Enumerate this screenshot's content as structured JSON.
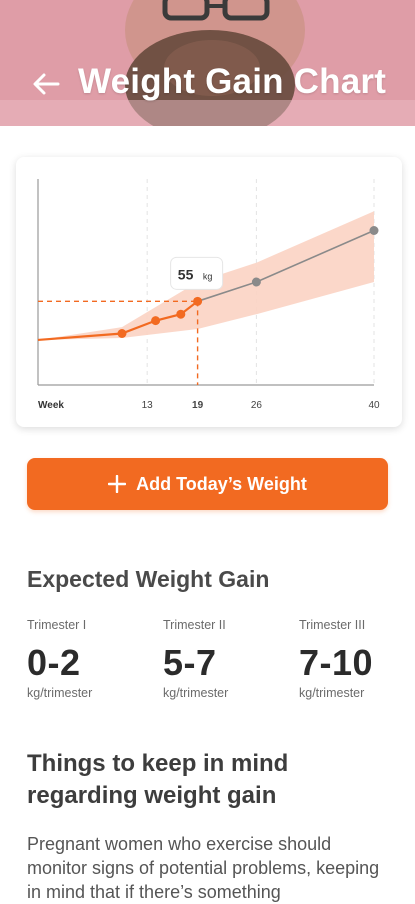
{
  "header": {
    "title": "Weight Gain Chart",
    "back_icon": "arrow-left-icon"
  },
  "chart_data": {
    "type": "line",
    "x_tick_labels": [
      "Week",
      "13",
      "19",
      "26",
      "40"
    ],
    "x_ticks": [
      13,
      19,
      26,
      40
    ],
    "xlim": [
      0,
      40
    ],
    "actual_series": {
      "x": [
        0,
        10,
        14,
        17,
        19
      ],
      "y": [
        47,
        48,
        50,
        51,
        53
      ]
    },
    "projected_series": {
      "x": [
        19,
        26,
        40
      ],
      "y": [
        53,
        56,
        64
      ]
    },
    "expected_range": {
      "x": [
        0,
        10,
        19,
        26,
        40
      ],
      "low": [
        47,
        47.3,
        48.7,
        51,
        56
      ],
      "high": [
        47,
        49,
        56,
        59,
        67
      ]
    },
    "highlight": {
      "x": 19,
      "y": 53,
      "label_value": "55",
      "label_unit": "kg"
    },
    "colors": {
      "accent": "#f26a21",
      "band": "#fbd3c3",
      "projected": "#8a8a8a",
      "grid": "#e3e3e3"
    }
  },
  "actions": {
    "add_weight_label": "Add Today’s Weight",
    "add_icon": "plus-icon"
  },
  "expected": {
    "title": "Expected Weight Gain",
    "trimesters": [
      {
        "name": "Trimester I",
        "value": "0-2",
        "unit": "kg/trimester"
      },
      {
        "name": "Trimester II",
        "value": "5-7",
        "unit": "kg/trimester"
      },
      {
        "name": "Trimester III",
        "value": "7-10",
        "unit": "kg/trimester"
      }
    ]
  },
  "tips": {
    "title": "Things to keep in mind regarding weight gain",
    "body": "Pregnant women who exercise should monitor signs of potential problems, keeping in mind that if there’s something"
  }
}
